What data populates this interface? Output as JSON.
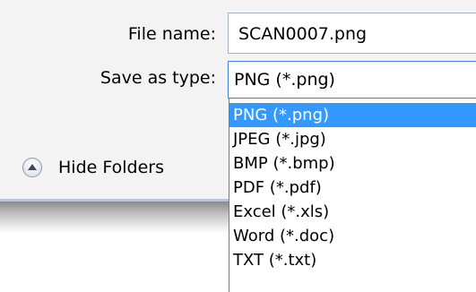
{
  "form": {
    "filename_label": "File name:",
    "filename_value": "SCAN0007.png",
    "saveas_label": "Save as type:",
    "saveas_value": "PNG (*.png)"
  },
  "dropdown": {
    "selected_index": 0,
    "options": [
      "PNG (*.png)",
      "JPEG (*.jpg)",
      "BMP (*.bmp)",
      "PDF (*.pdf)",
      "Excel (*.xls)",
      "Word (*.doc)",
      "TXT (*.txt)"
    ]
  },
  "footer": {
    "hide_folders_label": "Hide Folders",
    "hide_folders_icon": "chevron-up-icon"
  },
  "colors": {
    "selection": "#3399ff",
    "focus_border": "#3f82d8"
  }
}
